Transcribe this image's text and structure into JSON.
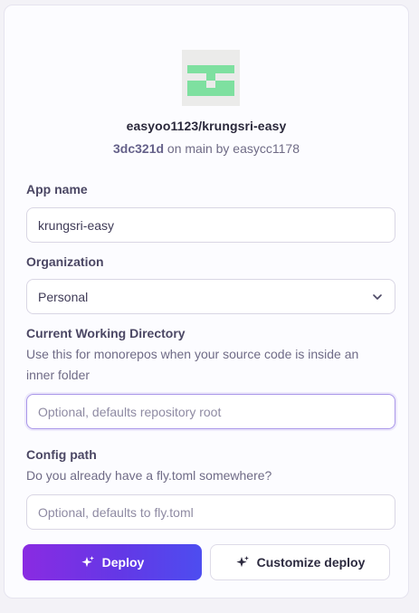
{
  "repo": {
    "full_name": "easyoo1123/krungsri-easy",
    "commit_sha": "3dc321d",
    "commit_rest": " on main by easycc1178"
  },
  "form": {
    "app_name": {
      "label": "App name",
      "value": "krungsri-easy"
    },
    "organization": {
      "label": "Organization",
      "selected": "Personal"
    },
    "cwd": {
      "label": "Current Working Directory",
      "help": "Use this for monorepos when your source code is inside an inner folder",
      "placeholder": "Optional, defaults repository root"
    },
    "config_path": {
      "label": "Config path",
      "help": "Do you already have a fly.toml somewhere?",
      "placeholder": "Optional, defaults to fly.toml"
    }
  },
  "actions": {
    "deploy_label": "Deploy",
    "customize_label": "Customize deploy"
  },
  "colors": {
    "primary_gradient_start": "#8a2be2",
    "primary_gradient_end": "#4d4df0",
    "avatar_green": "#7ee0a0"
  }
}
